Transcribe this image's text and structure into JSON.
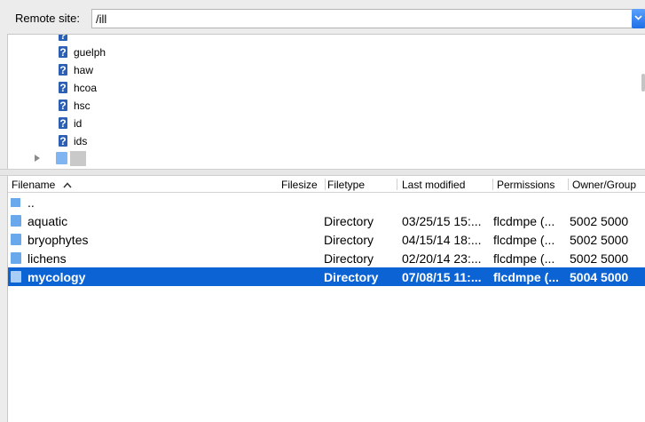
{
  "site": {
    "label": "Remote site:",
    "path": "/ill"
  },
  "tree": {
    "items": [
      {
        "label": "guelph"
      },
      {
        "label": "haw"
      },
      {
        "label": "hcoa"
      },
      {
        "label": "hsc"
      },
      {
        "label": "id"
      },
      {
        "label": "ids"
      }
    ],
    "unknown_icon_glyph": "?"
  },
  "file_list": {
    "columns": {
      "filename": "Filename",
      "filesize": "Filesize",
      "filetype": "Filetype",
      "last_modified": "Last modified",
      "permissions": "Permissions",
      "owner_group": "Owner/Group"
    },
    "sort_indicator": "^",
    "parent_entry": "..",
    "rows": [
      {
        "name": "aquatic",
        "type": "Directory",
        "modified": "03/25/15 15:...",
        "perms": "flcdmpe (...",
        "owner": "5002 5000"
      },
      {
        "name": "bryophytes",
        "type": "Directory",
        "modified": "04/15/14 18:...",
        "perms": "flcdmpe (...",
        "owner": "5002 5000"
      },
      {
        "name": "lichens",
        "type": "Directory",
        "modified": "02/20/14 23:...",
        "perms": "flcdmpe (...",
        "owner": "5002 5000"
      },
      {
        "name": "mycology",
        "type": "Directory",
        "modified": "07/08/15 11:...",
        "perms": "flcdmpe (...",
        "owner": "5004 5000",
        "selected": true
      }
    ]
  },
  "colors": {
    "selection": "#0b63d4",
    "folder": "#6aa8ec",
    "dropdown": "#1f6fe6"
  }
}
